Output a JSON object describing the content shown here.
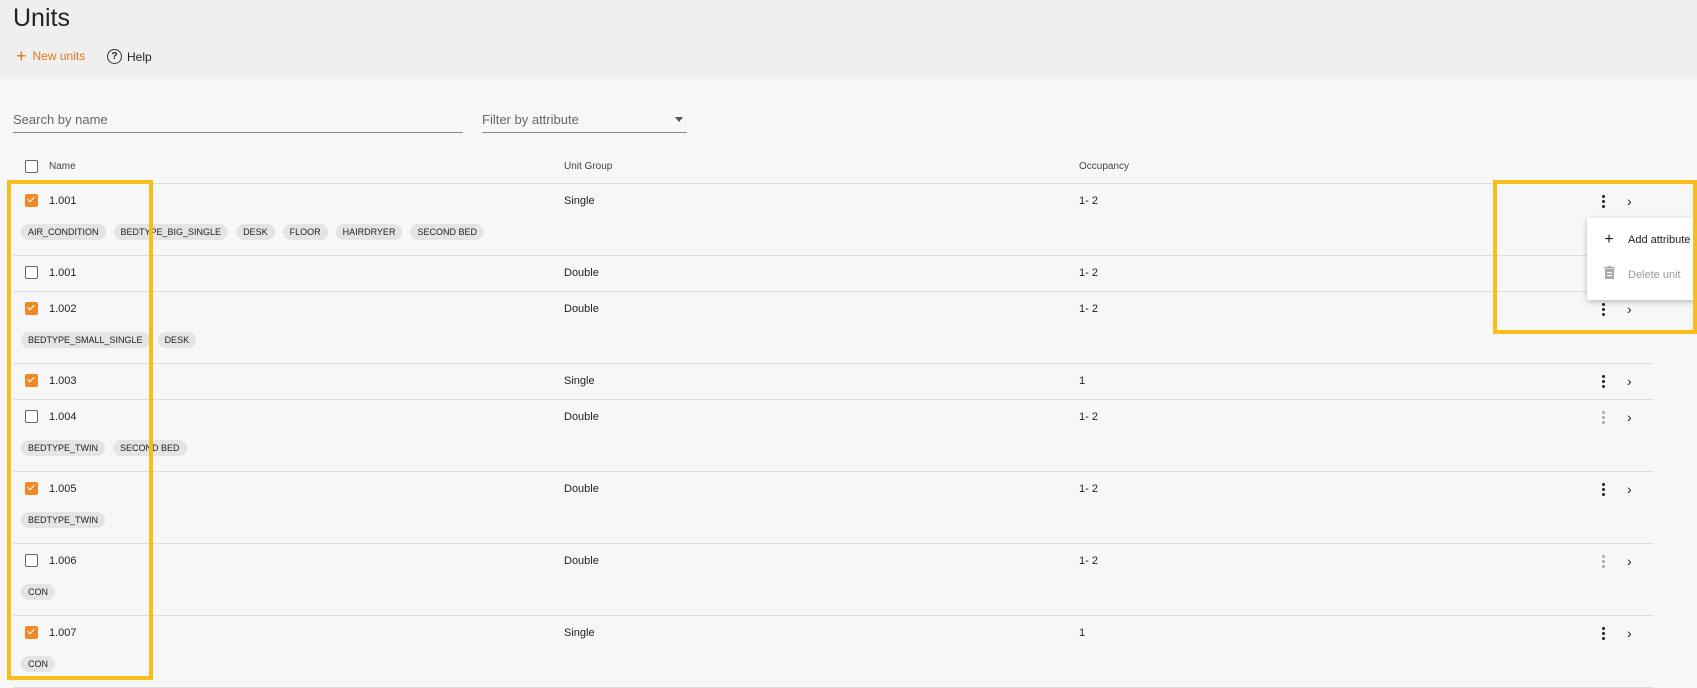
{
  "header": {
    "title": "Units",
    "new_label": "New units",
    "help_label": "Help"
  },
  "filters": {
    "search_placeholder": "Search by name",
    "attribute_placeholder": "Filter by attribute"
  },
  "table": {
    "columns": {
      "name": "Name",
      "group": "Unit Group",
      "occupancy": "Occupancy"
    },
    "rows": [
      {
        "name": "1.001",
        "group": "Single",
        "occupancy": "1- 2",
        "checked": true,
        "actions_enabled": true,
        "tags": [
          "AIR_CONDITION",
          "BEDTYPE_BIG_SINGLE",
          "DESK",
          "FLOOR",
          "HAIRDRYER",
          "SECOND BED"
        ]
      },
      {
        "name": "1.001",
        "group": "Double",
        "occupancy": "1- 2",
        "checked": false,
        "actions_enabled": true,
        "tags": []
      },
      {
        "name": "1.002",
        "group": "Double",
        "occupancy": "1- 2",
        "checked": true,
        "actions_enabled": true,
        "tags": [
          "BEDTYPE_SMALL_SINGLE",
          "DESK"
        ]
      },
      {
        "name": "1.003",
        "group": "Single",
        "occupancy": "1",
        "checked": true,
        "actions_enabled": true,
        "tags": []
      },
      {
        "name": "1.004",
        "group": "Double",
        "occupancy": "1- 2",
        "checked": false,
        "actions_enabled": false,
        "tags": [
          "BEDTYPE_TWIN",
          "SECOND BED"
        ]
      },
      {
        "name": "1.005",
        "group": "Double",
        "occupancy": "1- 2",
        "checked": true,
        "actions_enabled": true,
        "tags": [
          "BEDTYPE_TWIN"
        ]
      },
      {
        "name": "1.006",
        "group": "Double",
        "occupancy": "1- 2",
        "checked": false,
        "actions_enabled": false,
        "tags": [
          "CON"
        ]
      },
      {
        "name": "1.007",
        "group": "Single",
        "occupancy": "1",
        "checked": true,
        "actions_enabled": true,
        "tags": [
          "CON"
        ]
      }
    ]
  },
  "context_menu": {
    "add_label": "Add attribute",
    "delete_label": "Delete unit"
  },
  "colors": {
    "accent": "#ee8a26",
    "highlight": "#f7bd1a"
  },
  "icons": [
    "plus-icon",
    "help-icon",
    "caret-down-icon",
    "kebab-icon",
    "chevron-right-icon",
    "trash-icon"
  ]
}
